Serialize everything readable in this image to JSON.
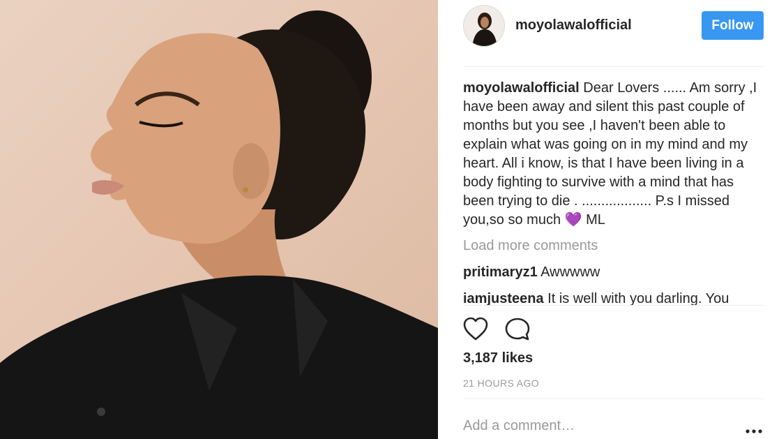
{
  "post": {
    "username": "moyolawalofficial",
    "follow_label": "Follow",
    "caption": {
      "username": "moyolawalofficial",
      "text": "Dear Lovers ...... Am sorry ,I have been away and silent this past couple of months but you see ,I haven't been able to explain what was going on in my mind and my heart. All i know, is that I have been living in a body fighting to survive with a mind that has been trying to die . .................. P.s I missed you,so so much ",
      "emoji": "💜",
      "signoff": " ML"
    },
    "load_more_label": "Load more comments",
    "comments": [
      {
        "username": "pritimaryz1",
        "text": "Awwwww"
      },
      {
        "username": "iamjusteena",
        "text": "It is well with you darling. You"
      }
    ],
    "likes": "3,187 likes",
    "timestamp": "21 HOURS AGO",
    "add_comment_placeholder": "Add a comment…",
    "colors": {
      "follow_button": "#3897f0",
      "muted_text": "#999999",
      "text": "#262626"
    },
    "icons": {
      "like": "heart-outline-icon",
      "comment": "speech-bubble-icon",
      "more": "ellipsis-icon"
    }
  }
}
